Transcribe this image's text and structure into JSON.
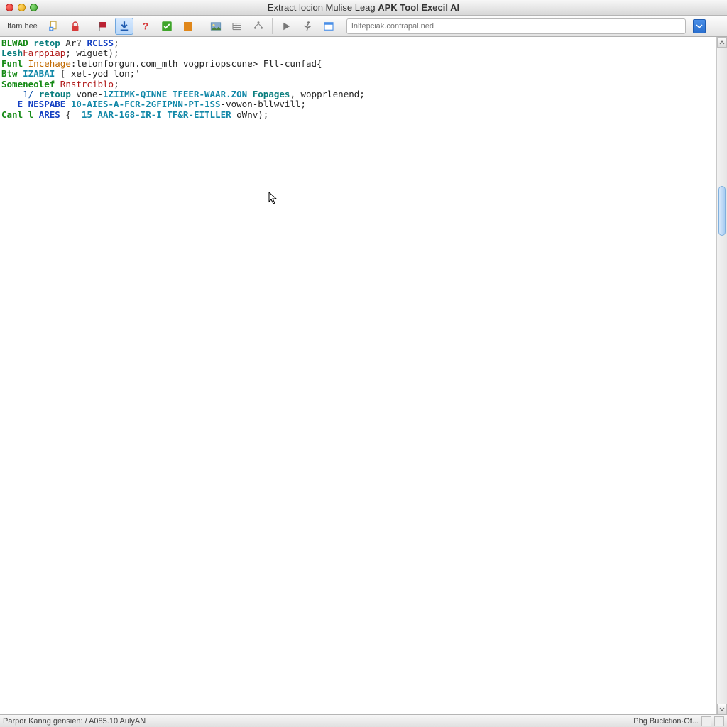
{
  "window": {
    "title_prefix": "Extract locion Mulise Leag ",
    "title_bold": "APK Tool Execil AI"
  },
  "toolbar": {
    "item_label": "Itam hee",
    "search_placeholder": "Inltepciak.confrapal.ned"
  },
  "code": {
    "lines": [
      {
        "raw": "BLWAD retop Ar? RCLSS;",
        "tokens": [
          {
            "t": "BLWAD",
            "c": "kw-green"
          },
          {
            "t": " "
          },
          {
            "t": "retop",
            "c": "kw-teal"
          },
          {
            "t": " Ar? "
          },
          {
            "t": "RCLSS",
            "c": "kw-blue"
          },
          {
            "t": ";"
          }
        ]
      },
      {
        "raw": "LeshFarppiap; wiguet);",
        "tokens": [
          {
            "t": "Lesh",
            "c": "kw-teal"
          },
          {
            "t": "Farppiap",
            "c": "kw-red"
          },
          {
            "t": "; wiguet);"
          }
        ]
      },
      {
        "raw": "Funl Incehage:letonforgun.com_mth vogpriopscune> Fll-cunfad{",
        "tokens": [
          {
            "t": "Funl",
            "c": "kw-green"
          },
          {
            "t": " "
          },
          {
            "t": "Incehage",
            "c": "kw-orange"
          },
          {
            "t": ":letonforgun.com_mth vogpriopscune> Fll-cunfad{"
          }
        ]
      },
      {
        "raw": "Btw IZABAI [ xet-yod lon;'",
        "tokens": [
          {
            "t": "Btw",
            "c": "kw-green"
          },
          {
            "t": " "
          },
          {
            "t": "IZABAI",
            "c": "const"
          },
          {
            "t": " [ xet-yod lon;'"
          }
        ]
      },
      {
        "raw": "Someneolef Rnstrciblo;",
        "tokens": [
          {
            "t": "Someneolef",
            "c": "kw-green"
          },
          {
            "t": " "
          },
          {
            "t": "Rnstrciblo",
            "c": "kw-red"
          },
          {
            "t": ";"
          }
        ]
      },
      {
        "raw": "    1/ retoup vone-1ZIIMK-QINNE TFEER-WAAR.ZON Fopages, wopprlenend;",
        "tokens": [
          {
            "t": "    "
          },
          {
            "t": "1/",
            "c": "str-blue"
          },
          {
            "t": " "
          },
          {
            "t": "retoup",
            "c": "kw-teal"
          },
          {
            "t": " vone-"
          },
          {
            "t": "1ZIIMK-QINNE TFEER-WAAR.ZON",
            "c": "const"
          },
          {
            "t": " "
          },
          {
            "t": "Fopages",
            "c": "kw-teal"
          },
          {
            "t": ", wopprlenend;"
          }
        ]
      },
      {
        "raw": "   E NESPABE 10-AIES-A-FCR-2GFIPNN-PT-1SS-vowon-bllwvill;",
        "tokens": [
          {
            "t": "   "
          },
          {
            "t": "E NESPABE",
            "c": "kw-blue"
          },
          {
            "t": " "
          },
          {
            "t": "10-AIES-A-FCR-2GFIPNN-PT-1SS",
            "c": "const"
          },
          {
            "t": "-vowon-bllwvill;"
          }
        ]
      },
      {
        "raw": "Canl l ARES {  15 AAR-168-IR-I TF&R-EITLLER oWnv);",
        "tokens": [
          {
            "t": "Canl l",
            "c": "kw-green"
          },
          {
            "t": " "
          },
          {
            "t": "ARES",
            "c": "kw-blue"
          },
          {
            "t": " {  "
          },
          {
            "t": "15 AAR-168-IR-I TF&R-EITLLER",
            "c": "const"
          },
          {
            "t": " oWnv);"
          }
        ]
      }
    ]
  },
  "status": {
    "left": "Parpor Kanng gensien: / A085.10 AulyAN",
    "right": "Phg Buclction·Ot..."
  },
  "icons": {
    "new_file": "new-file-icon",
    "lock": "lock-icon",
    "flag": "flag-icon",
    "download": "download-icon",
    "question": "question-icon",
    "check": "check-icon",
    "square": "square-icon",
    "picture": "picture-icon",
    "list": "list-icon",
    "tree": "tree-icon",
    "play": "play-icon",
    "person": "person-run-icon",
    "window": "window-icon"
  }
}
